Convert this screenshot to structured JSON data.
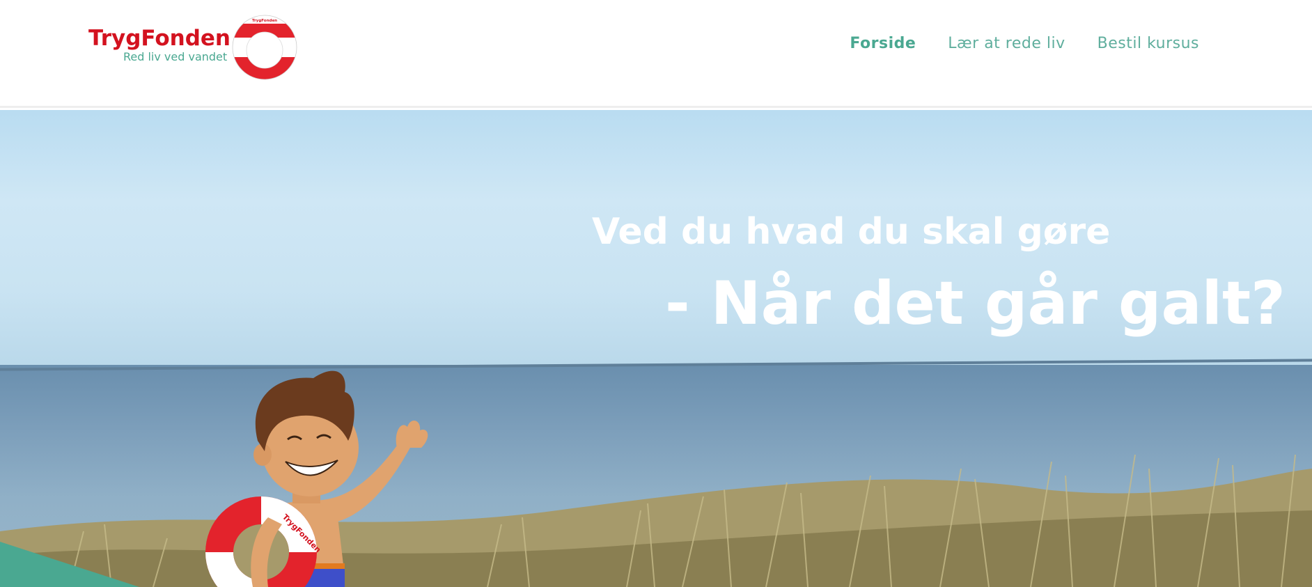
{
  "header": {
    "logo": {
      "brand": "TrygFonden",
      "tagline": "Red liv ved vandet",
      "ring_text": "TrygFonden"
    },
    "nav": [
      {
        "label": "Forside",
        "active": true
      },
      {
        "label": "Lær at rede liv",
        "active": false
      },
      {
        "label": "Bestil kursus",
        "active": false
      }
    ]
  },
  "hero": {
    "title_line_1": "Ved du hvad du skal gøre",
    "title_line_2": "- Når det går galt?",
    "mascot_ring_text": "TrygFonden"
  },
  "colors": {
    "brand_red": "#d3121f",
    "accent_teal": "#4aa891",
    "nav_teal": "#5fae9d"
  },
  "icons": [
    "lifebuoy-logo-icon",
    "mascot-illustration"
  ]
}
